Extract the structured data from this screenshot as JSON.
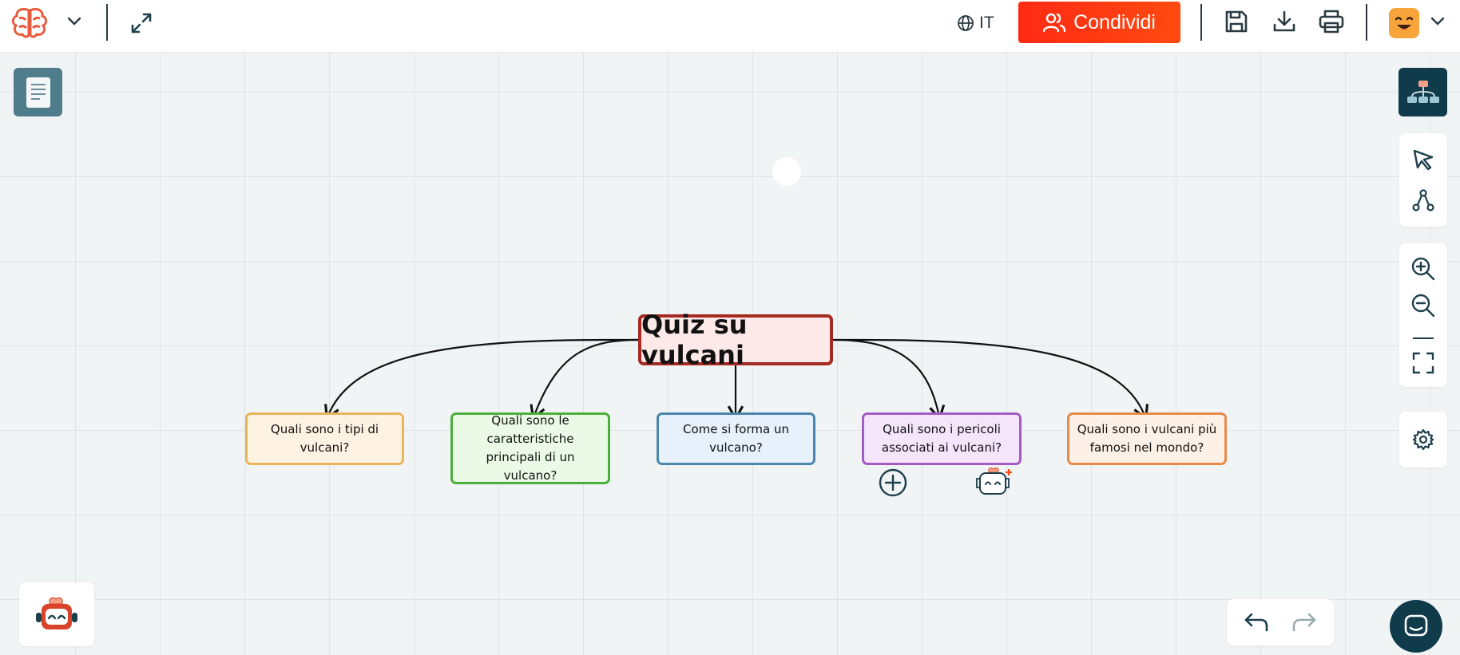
{
  "header": {
    "language_label": "IT",
    "share_label": "Condividi"
  },
  "icons": {
    "logo": "brain-logo-icon",
    "menu": "chevron-down-icon",
    "expand": "expand-icon",
    "globe": "globe-icon",
    "users": "users-icon",
    "save": "save-icon",
    "download": "download-icon",
    "print": "print-icon",
    "avatar": "avatar-face-icon",
    "document": "document-icon",
    "layout": "mindmap-layout-icon",
    "pointer": "cursor-pointer-icon",
    "connect": "connection-icon",
    "zoom_in": "zoom-in-icon",
    "zoom_out": "zoom-out-icon",
    "fit": "fit-screen-icon",
    "settings": "gear-icon",
    "add": "plus-circle-icon",
    "ai_assistant": "robot-icon",
    "undo": "undo-icon",
    "redo": "redo-icon",
    "chat": "chat-icon"
  },
  "colors": {
    "accent": "#ff2a14",
    "dark": "#0f3b4a",
    "node_1_border": "#e8b55a",
    "node_2_border": "#4caf3c",
    "node_3_border": "#4a86ad",
    "node_4_border": "#a45bc3",
    "node_5_border": "#e88a4a",
    "root_border": "#a52a22"
  },
  "mindmap": {
    "root": "Quiz su vulcani",
    "nodes": [
      {
        "text": "Quali sono i tipi di vulcani?"
      },
      {
        "text": "Quali sono le caratteristiche principali di un vulcano?"
      },
      {
        "text": "Come si forma un vulcano?"
      },
      {
        "text": "Quali sono i pericoli associati ai vulcani?"
      },
      {
        "text": "Quali sono i vulcani più famosi nel mondo?"
      }
    ]
  }
}
